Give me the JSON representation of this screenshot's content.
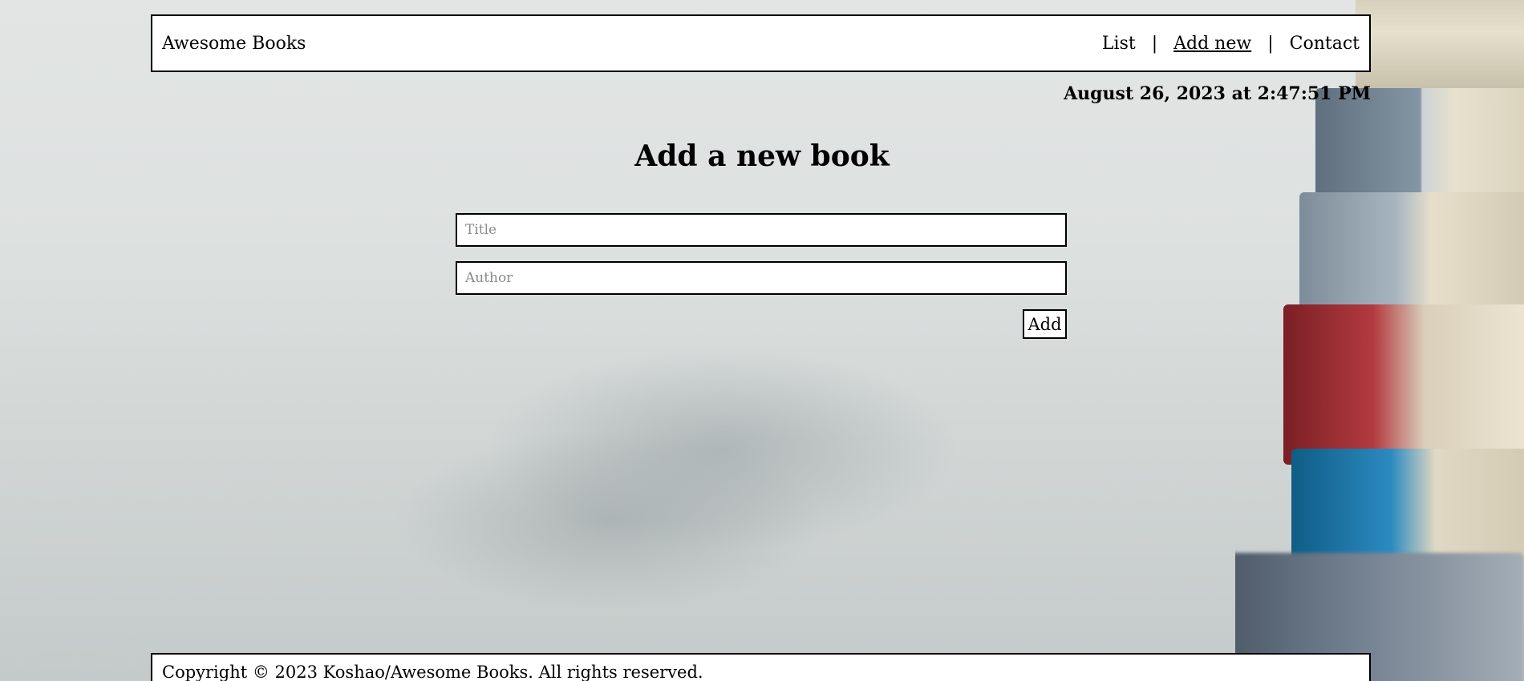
{
  "header": {
    "logo": "Awesome Books",
    "nav": {
      "list": "List",
      "separator": "|",
      "add_new": "Add new",
      "contact": "Contact"
    }
  },
  "datetime": "August 26, 2023 at 2:47:51 PM",
  "form": {
    "heading": "Add a new book",
    "title_placeholder": "Title",
    "title_value": "",
    "author_placeholder": "Author",
    "author_value": "",
    "submit_label": "Add"
  },
  "footer": {
    "copyright": "Copyright © 2023 Koshao/Awesome Books. All rights reserved."
  }
}
